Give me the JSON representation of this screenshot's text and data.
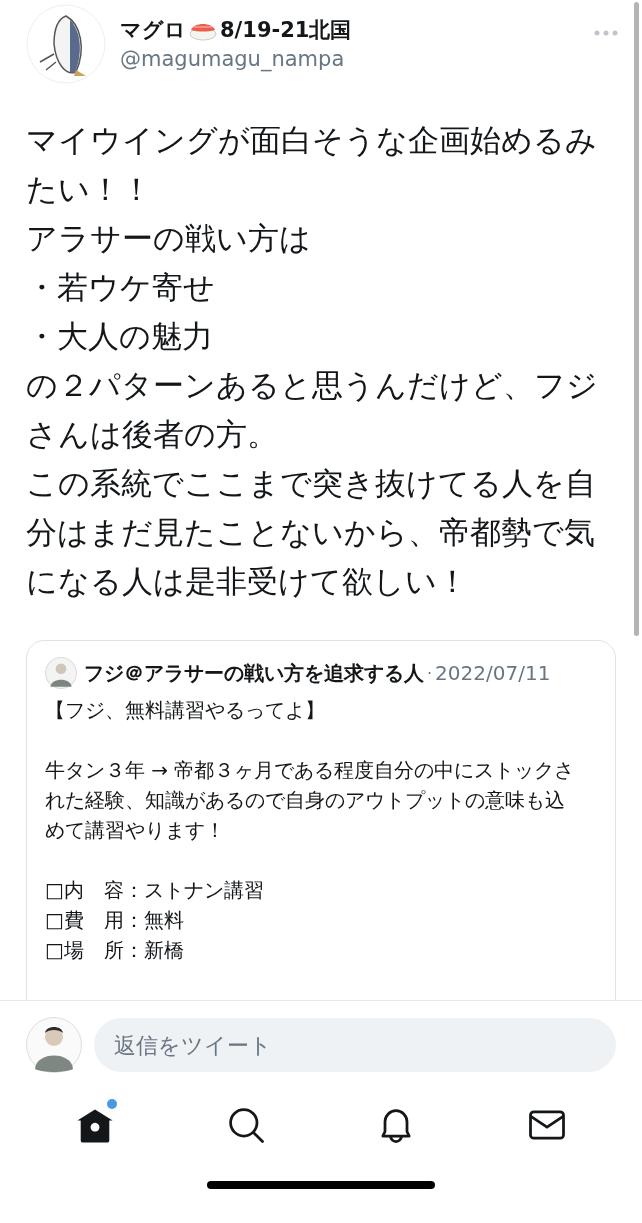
{
  "author": {
    "name_before": "マグロ",
    "name_after": "8/19-21北国",
    "handle": "@magumagu_nampa"
  },
  "tweet": {
    "paragraphs": [
      "マイウイングが面白そうな企画始めるみたい！！",
      "アラサーの戦い方は",
      "・若ウケ寄せ",
      "・大人の魅力",
      "の２パターンあると思うんだけど、フジさんは後者の方。",
      "この系統でここまで突き抜けてる人を自分はまだ見たことないから、帝都勢で気になる人は是非受けて欲しい！"
    ]
  },
  "quote": {
    "name": "フジ＠アラサーの戦い方を追求する人",
    "separator": "·",
    "date": "2022/07/11",
    "blocks": [
      {
        "lines": [
          "【フジ、無料講習やるってよ】"
        ]
      },
      {
        "lines": [
          "牛タン３年 → 帝都３ヶ月である程度自分の中にストックされた経験、知識があるので自身のアウトプットの意味も込めて講習やります！"
        ]
      },
      {
        "lines": [
          "□内　容：ストナン講習",
          "□費　用：無料",
          "□場　所：新橋"
        ]
      }
    ]
  },
  "reply": {
    "placeholder": "返信をツイート"
  },
  "nav": [
    {
      "kind": "home",
      "selected": true,
      "badge": true
    },
    {
      "kind": "search",
      "selected": false,
      "badge": false
    },
    {
      "kind": "notifications",
      "selected": false,
      "badge": false
    },
    {
      "kind": "messages",
      "selected": false,
      "badge": false
    }
  ]
}
